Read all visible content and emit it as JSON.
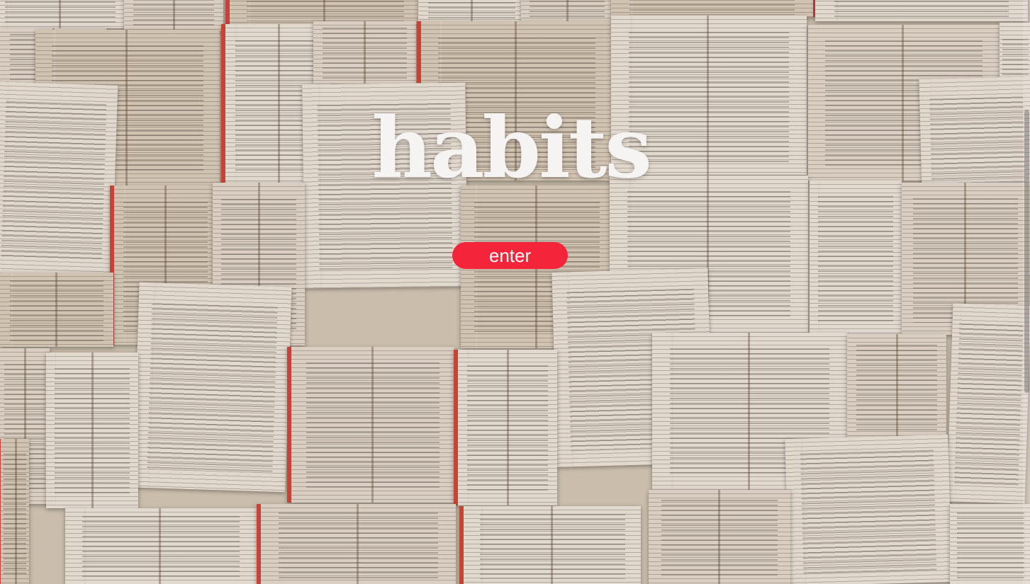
{
  "hero": {
    "title": "habits",
    "enter_label": "enter"
  },
  "colors": {
    "accent": "#f4243a",
    "title_text": "#f6f4f2",
    "page_paper": "#e9ded0",
    "book_edge_red": "#d2483a"
  },
  "background": {
    "description_icon": "book-pages-collage"
  }
}
